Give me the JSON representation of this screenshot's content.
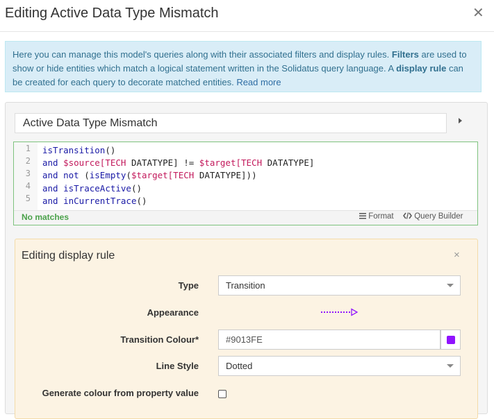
{
  "dialog": {
    "title": "Editing Active Data Type Mismatch",
    "close_symbol": "✕"
  },
  "info": {
    "text_1": "Here you can manage this model's queries along with their associated filters and display rules. ",
    "bold_filters": "Filters",
    "text_2": " are used to show or hide entities which match a logical statement written in the Solidatus query language. A ",
    "bold_display_rule": "display rule",
    "text_3": " can be created for each query to decorate matched entities. ",
    "link": "Read more"
  },
  "query": {
    "name": "Active Data Type Mismatch",
    "line_numbers": [
      "1",
      "2",
      "3",
      "4",
      "5"
    ],
    "lines": [
      [
        {
          "t": "isTransition",
          "c": "kw"
        },
        {
          "t": "()",
          "c": "pl"
        }
      ],
      [
        {
          "t": "and ",
          "c": "kw"
        },
        {
          "t": "$source[TECH ",
          "c": "var"
        },
        {
          "t": "DATATYPE] != ",
          "c": "pl"
        },
        {
          "t": "$target[TECH ",
          "c": "var"
        },
        {
          "t": "DATATYPE]",
          "c": "pl"
        }
      ],
      [
        {
          "t": "and not ",
          "c": "kw"
        },
        {
          "t": "(",
          "c": "pl"
        },
        {
          "t": "isEmpty",
          "c": "kw"
        },
        {
          "t": "(",
          "c": "pl"
        },
        {
          "t": "$target[TECH ",
          "c": "var"
        },
        {
          "t": "DATATYPE]))",
          "c": "pl"
        }
      ],
      [
        {
          "t": "and ",
          "c": "kw"
        },
        {
          "t": "isTraceActive",
          "c": "kw"
        },
        {
          "t": "()",
          "c": "pl"
        }
      ],
      [
        {
          "t": "and ",
          "c": "kw"
        },
        {
          "t": "inCurrentTrace",
          "c": "kw"
        },
        {
          "t": "()",
          "c": "pl"
        }
      ]
    ],
    "status": "No matches",
    "format_label": "Format",
    "query_builder_label": "Query Builder"
  },
  "display_rule": {
    "title": "Editing display rule",
    "close_symbol": "×",
    "type_label": "Type",
    "type_value": "Transition",
    "appearance_label": "Appearance",
    "colour_label": "Transition Colour*",
    "colour_value": "#9013FE",
    "line_style_label": "Line Style",
    "line_style_value": "Dotted",
    "generate_label": "Generate colour from property value",
    "generate_checked": false
  },
  "icons": {
    "close": "close-icon",
    "expand": "caret-right-icon",
    "format": "list-icon",
    "query_builder": "code-icon",
    "dropdown": "chevron-down-icon",
    "swatch": "colour-swatch-icon"
  },
  "colors": {
    "accent": "#9013FE",
    "info_bg": "#d9edf7",
    "rule_bg": "#fcf3e3",
    "match_status": "#4aa14a"
  }
}
